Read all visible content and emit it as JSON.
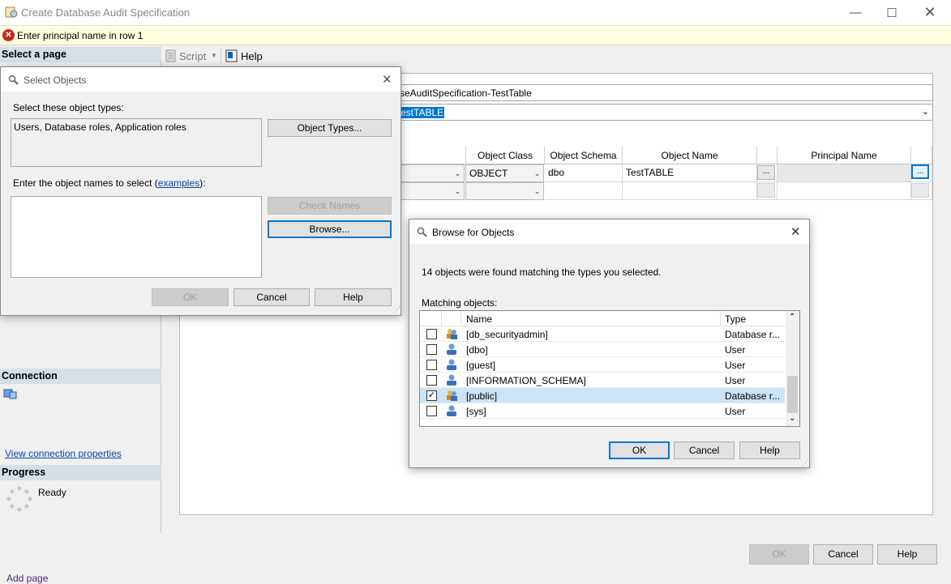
{
  "window": {
    "title": "Create Database Audit Specification",
    "minimize_icon": "minimize-icon",
    "maximize_icon": "maximize-icon",
    "close_icon": "close-icon"
  },
  "error_bar": {
    "message": "Enter principal name in row 1"
  },
  "left_pane": {
    "select_page_header": "Select a page",
    "connection_header": "Connection",
    "view_connection_link": "View connection properties",
    "progress_header": "Progress",
    "progress_status": "Ready",
    "add_page_partial": "Add page"
  },
  "toolbar": {
    "script_label": "Script",
    "help_label": "Help"
  },
  "main": {
    "name_value_partial": "seAuditSpecification-TestTable",
    "audit_value_partial": "estTABLE",
    "grid": {
      "headers": [
        "Object Class",
        "Object Schema",
        "Object Name",
        "Principal Name"
      ],
      "row1": {
        "object_class": "OBJECT",
        "object_schema": "dbo",
        "object_name": "TestTABLE",
        "principal_name": ""
      },
      "ellipsis": "..."
    }
  },
  "footer": {
    "ok": "OK",
    "cancel": "Cancel",
    "help": "Help"
  },
  "select_objects": {
    "title": "Select Objects",
    "object_types_label": "Select these object types:",
    "object_types_value": "Users, Database roles, Application roles",
    "object_types_button": "Object Types...",
    "enter_names_label_pre": "Enter the object names to select (",
    "enter_names_link": "examples",
    "enter_names_label_post": "):",
    "check_names_button": "Check Names",
    "browse_button": "Browse...",
    "ok": "OK",
    "cancel": "Cancel",
    "help": "Help"
  },
  "browse_objects": {
    "title": "Browse for Objects",
    "found_text": "14 objects were found matching the types you selected.",
    "matching_label": "Matching objects:",
    "columns": {
      "name": "Name",
      "type": "Type"
    },
    "rows": [
      {
        "name": "[db_securityadmin]",
        "type": "Database r...",
        "checked": false,
        "icon": "role-icon"
      },
      {
        "name": "[dbo]",
        "type": "User",
        "checked": false,
        "icon": "user-icon"
      },
      {
        "name": "[guest]",
        "type": "User",
        "checked": false,
        "icon": "user-icon"
      },
      {
        "name": "[INFORMATION_SCHEMA]",
        "type": "User",
        "checked": false,
        "icon": "user-icon"
      },
      {
        "name": "[public]",
        "type": "Database r...",
        "checked": true,
        "icon": "role-icon"
      },
      {
        "name": "[sys]",
        "type": "User",
        "checked": false,
        "icon": "user-icon"
      }
    ],
    "ok": "OK",
    "cancel": "Cancel",
    "help": "Help"
  },
  "colors": {
    "error_bar_bg": "#ffffe1",
    "selection": "#cce4f7",
    "accent": "#0078d7",
    "section_header": "#d5dfe8"
  }
}
